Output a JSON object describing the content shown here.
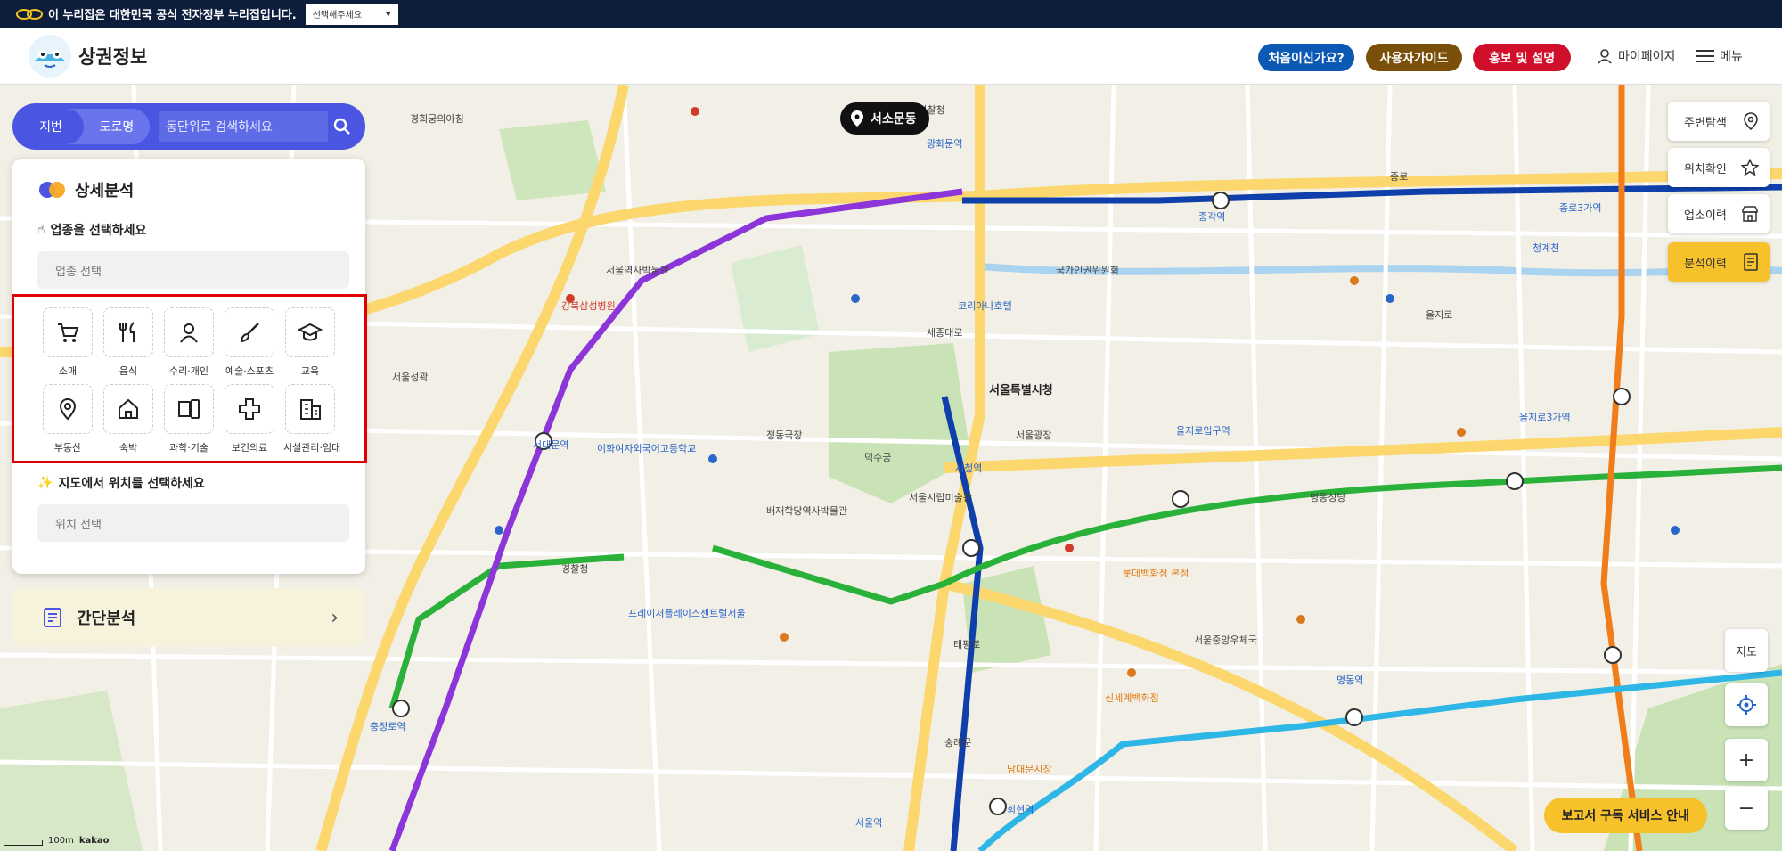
{
  "gov_bar": {
    "text": "이 누리집은 대한민국 공식 전자정부 누리집입니다.",
    "select_label": "선택해주세요"
  },
  "header": {
    "title": "상권정보",
    "buttons": [
      {
        "label": "처음이신가요?",
        "color": "#0c59b4"
      },
      {
        "label": "사용자가이드",
        "color": "#7a4f0a"
      },
      {
        "label": "홍보 및 설명",
        "color": "#d0102a"
      }
    ],
    "mypage": "마이페이지",
    "menu": "메뉴"
  },
  "search": {
    "tabs": [
      "지번",
      "도로명"
    ],
    "placeholder": "동단위로 검색하세요"
  },
  "panel": {
    "title": "상세분석",
    "industry_label": "업종을 선택하세요",
    "industry_placeholder": "업종 선택",
    "categories": [
      "소매",
      "음식",
      "수리·개인",
      "예술·스포츠",
      "교육",
      "부동산",
      "숙박",
      "과학·기술",
      "보건의료",
      "시설관리·임대"
    ],
    "location_label": "지도에서 위치를 선택하세요",
    "location_placeholder": "위치 선택"
  },
  "simple_analysis": {
    "label": "간단분석"
  },
  "right_tools": [
    {
      "label": "주변탐색",
      "icon": "pin-icon"
    },
    {
      "label": "위치확인",
      "icon": "star-icon"
    },
    {
      "label": "업소이력",
      "icon": "store-icon"
    },
    {
      "label": "분석이력",
      "icon": "document-icon"
    }
  ],
  "map_controls": {
    "map_type": "지도",
    "zoom_in": "+",
    "zoom_out": "−"
  },
  "place_marker": "서소문동",
  "promo": "보고서 구독 서비스 안내",
  "scale": {
    "value": "100m",
    "brand": "kakao"
  },
  "map_labels": [
    {
      "text": "서울특별시청",
      "style": "bold"
    },
    {
      "text": "서울광장",
      "style": ""
    },
    {
      "text": "덕수궁",
      "style": ""
    },
    {
      "text": "시청역",
      "style": "blue"
    },
    {
      "text": "종각역",
      "style": "blue"
    },
    {
      "text": "을지로입구역",
      "style": "blue"
    },
    {
      "text": "서대문역",
      "style": "blue"
    },
    {
      "text": "충정로역",
      "style": "blue"
    },
    {
      "text": "회현역",
      "style": "blue"
    },
    {
      "text": "서울역",
      "style": "blue"
    },
    {
      "text": "광화문역",
      "style": "blue"
    },
    {
      "text": "종로3가역",
      "style": "blue"
    },
    {
      "text": "을지로3가역",
      "style": "blue"
    },
    {
      "text": "명동역",
      "style": "blue"
    },
    {
      "text": "경희궁의아침",
      "style": ""
    },
    {
      "text": "서울역사박물관",
      "style": ""
    },
    {
      "text": "강북삼성병원",
      "style": "red"
    },
    {
      "text": "이화여자외국어고등학교",
      "style": "blue"
    },
    {
      "text": "정동극장",
      "style": ""
    },
    {
      "text": "서울시립미술관",
      "style": ""
    },
    {
      "text": "배재학당역사박물관",
      "style": ""
    },
    {
      "text": "청계천",
      "style": "blue"
    },
    {
      "text": "명동성당",
      "style": ""
    },
    {
      "text": "롯데백화점 본점",
      "style": "orange"
    },
    {
      "text": "신세계백화점",
      "style": "orange"
    },
    {
      "text": "남대문시장",
      "style": "orange"
    },
    {
      "text": "숭례문",
      "style": ""
    },
    {
      "text": "서울중앙우체국",
      "style": ""
    },
    {
      "text": "종로",
      "style": ""
    },
    {
      "text": "을지로",
      "style": ""
    },
    {
      "text": "세종대로",
      "style": ""
    },
    {
      "text": "태평로",
      "style": ""
    },
    {
      "text": "코리아나호텔",
      "style": "blue"
    },
    {
      "text": "프레이저플레이스센트럴서울",
      "style": "blue"
    },
    {
      "text": "경찰청",
      "style": ""
    },
    {
      "text": "서울성곽",
      "style": ""
    },
    {
      "text": "국가인권위원회",
      "style": ""
    },
    {
      "text": "서울경찰청",
      "style": ""
    }
  ],
  "colors": {
    "line1": "#0e3faa",
    "line2": "#2ab13a",
    "line3": "#f07c1a",
    "line4": "#2eb6e6",
    "line5": "#8c36d9",
    "road_major": "#fbd76e",
    "road": "#ffffff",
    "park": "#c9e3b6",
    "water": "#a9d3ef",
    "accent": "#4a56e2"
  }
}
